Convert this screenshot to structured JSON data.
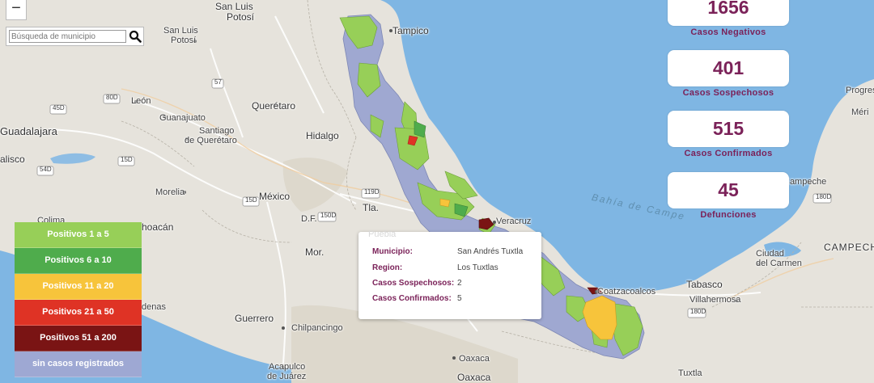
{
  "zoom": {
    "minus_label": "−"
  },
  "search": {
    "placeholder": "Búsqueda de municipio"
  },
  "stats": [
    {
      "value": "1656",
      "label": "Casos Negativos"
    },
    {
      "value": "401",
      "label": "Casos Sospechosos"
    },
    {
      "value": "515",
      "label": "Casos Confirmados"
    },
    {
      "value": "45",
      "label": "Defunciones"
    }
  ],
  "legend": [
    {
      "label": "Positivos 1 a 5",
      "color": "#97cf58"
    },
    {
      "label": "Positivos 6 a 10",
      "color": "#4fac4c"
    },
    {
      "label": "Positivos 11 a 20",
      "color": "#f7c43b"
    },
    {
      "label": "Positivos 21 a 50",
      "color": "#df3325"
    },
    {
      "label": "Positivos 51 a 200",
      "color": "#7a1414"
    },
    {
      "label": "sin casos registrados",
      "color": "#9ea8d3"
    }
  ],
  "tooltip": {
    "faded_label": "Puebla",
    "rows": [
      {
        "key": "Municipio:",
        "value": "San Andrés Tuxtla"
      },
      {
        "key": "Region:",
        "value": "Los Tuxtlas"
      },
      {
        "key": "Casos Sospechosos:",
        "value": "2"
      },
      {
        "key": "Casos Confirmados:",
        "value": "5"
      }
    ]
  },
  "map_labels": {
    "san_luis": "San Luis",
    "potosi": "Potosí",
    "tampico": "Tampico",
    "leon": "León",
    "guanajuato": "Guanajuato",
    "queretaro": "Querétaro",
    "santiago": "Santiago",
    "de_queretaro": "de Querétaro",
    "guadalajara": "Guadalajara",
    "jalisco": "alisco",
    "hidalgo": "Hidalgo",
    "morelia": "Morelia",
    "mexico": "México",
    "df": "D.F.",
    "tlax": "Tla.",
    "mor": "Mor.",
    "colima": "Colima",
    "michoacan": "hoacán",
    "guerrero": "Guerrero",
    "chilpancingo": "Chilpancingo",
    "acapulco": "Acapulco",
    "de_juarez": "de Juárez",
    "oaxaca": "Oaxaca",
    "oaxaca2": "Oaxaca",
    "lazaro": "denas",
    "veracruz": "Veracruz",
    "coatzacoalcos": "Coatzacoalcos",
    "tabasco": "Tabasco",
    "villahermosa": "Villahermosa",
    "campeche": "Campeche",
    "campeche_state": "CAMPECHE",
    "ciudad": "Ciudad",
    "del_carmen": "del Carmen",
    "bahia": "Bahía de Campe",
    "progreso": "Progres",
    "merida": "Méri",
    "tuxtla": "Tuxtla",
    "r57": "57",
    "r80d": "80D",
    "r45d": "45D",
    "r54d": "54D",
    "r15d": "15D",
    "r15d2": "15D",
    "r150d": "150D",
    "r119d": "119D",
    "r180d": "180D",
    "r180d2": "180D"
  }
}
